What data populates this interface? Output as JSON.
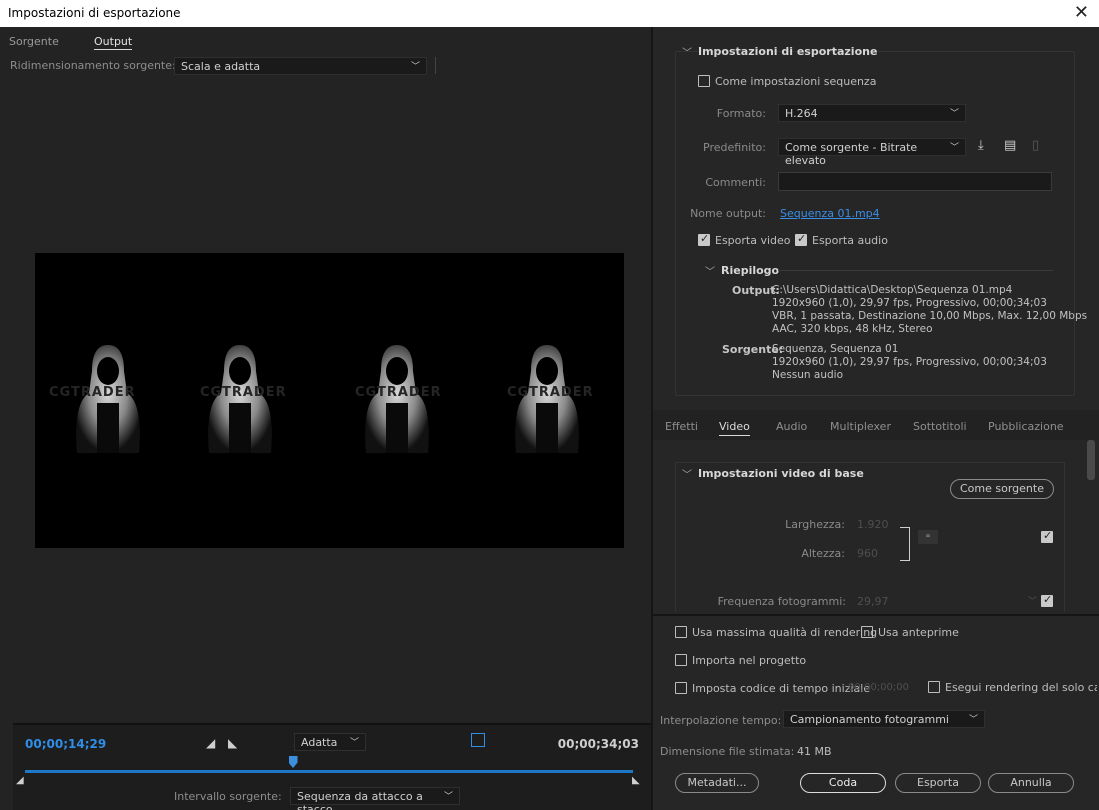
{
  "window": {
    "title": "Impostazioni di esportazione",
    "close": "✕"
  },
  "left": {
    "tabs": [
      "Sorgente",
      "Output"
    ],
    "resize_label": "Ridimensionamento sorgente:",
    "resize_value": "Scala e adatta",
    "timecode_current": "00;00;14;29",
    "fit_value": "Adatta",
    "timecode_end": "00;00;34;03",
    "range_label": "Intervallo sorgente:",
    "range_value": "Sequenza da attacco a stacco",
    "playhead_position": 0.44
  },
  "export": {
    "section_title": "Impostazioni di esportazione",
    "match_sequence": "Come impostazioni sequenza",
    "format_label": "Formato:",
    "format_value": "H.264",
    "preset_label": "Predefinito:",
    "preset_value": "Come sorgente - Bitrate elevato",
    "comments_label": "Commenti:",
    "output_name_label": "Nome output:",
    "output_name_value": "Sequenza 01.mp4",
    "export_video": "Esporta video",
    "export_audio": "Esporta audio",
    "summary_title": "Riepilogo",
    "summary_output_label": "Output:",
    "summary_output_lines": [
      "C:\\Users\\Didattica\\Desktop\\Sequenza 01.mp4",
      "1920x960 (1,0), 29,97 fps, Progressivo, 00;00;34;03",
      "VBR, 1 passata, Destinazione 10,00 Mbps, Max. 12,00 Mbps",
      "AAC, 320 kbps, 48 kHz, Stereo"
    ],
    "summary_source_label": "Sorgente:",
    "summary_source_lines": [
      "Sequenza, Sequenza 01",
      "1920x960 (1,0), 29,97 fps, Progressivo, 00;00;34;03",
      "Nessun audio"
    ]
  },
  "tabs": [
    "Effetti",
    "Video",
    "Audio",
    "Multiplexer",
    "Sottotitoli",
    "Pubblicazione"
  ],
  "video": {
    "section_title": "Impostazioni video di base",
    "match_source_button": "Come sorgente",
    "width_label": "Larghezza:",
    "width_value": "1.920",
    "height_label": "Altezza:",
    "height_value": "960",
    "framerate_label": "Frequenza fotogrammi:",
    "framerate_value": "29,97"
  },
  "bottom": {
    "max_quality": "Usa massima qualità di rendering",
    "use_previews": "Usa anteprime",
    "import_project": "Importa nel progetto",
    "set_start_tc": "Imposta codice di tempo iniziale",
    "start_tc_value": "00;00;00;00",
    "render_alpha": "Esegui rendering del solo canale",
    "interp_label": "Interpolazione tempo:",
    "interp_value": "Campionamento fotogrammi",
    "filesize_label": "Dimensione file stimata:",
    "filesize_value": "41 MB",
    "btn_metadata": "Metadati...",
    "btn_queue": "Coda",
    "btn_export": "Esporta",
    "btn_cancel": "Annulla"
  },
  "preview": {
    "watermark": "CGTRADER"
  }
}
